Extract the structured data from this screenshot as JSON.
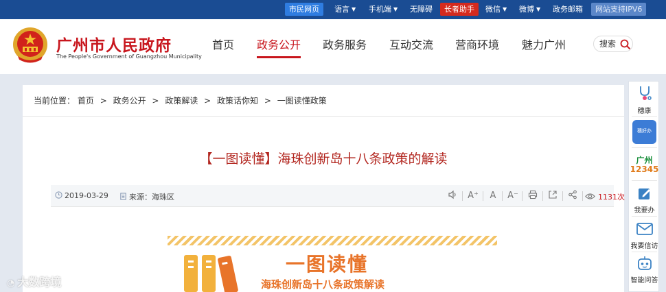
{
  "topbar": {
    "citizen": "市民网页",
    "language": "语言",
    "mobile": "手机端",
    "accessibility": "无障碍",
    "elder": "长者助手",
    "wechat": "微信",
    "weibo": "微博",
    "mail": "政务邮箱",
    "ipv6": "网站支持IPV6"
  },
  "header": {
    "title": "广州市人民政府",
    "subtitle": "The People's Government of Guangzhou Municipality",
    "nav": [
      "首页",
      "政务公开",
      "政务服务",
      "互动交流",
      "营商环境",
      "魅力广州"
    ],
    "active_tab": "政务公开",
    "search_label": "搜索"
  },
  "breadcrumb": {
    "prefix": "当前位置：",
    "items": [
      "首页",
      "政务公开",
      "政策解读",
      "政策话你知",
      "一图读懂政策"
    ],
    "separator": ">"
  },
  "article": {
    "title": "【一图读懂】海珠创新岛十八条政策的解读",
    "date": "2019-03-29",
    "source_label": "来源：",
    "source": "海珠区",
    "views": "1131次"
  },
  "banner": {
    "heading": "一图读懂",
    "subheading": "海珠创新岛十八条政策解读"
  },
  "sidebar": {
    "items": [
      "穗康",
      "穗好办",
      "广州",
      "12345",
      "我要办",
      "我要信访",
      "智能问答"
    ]
  },
  "watermark": "大数跨境",
  "colors": {
    "topbar": "#1a4c93",
    "accent_red": "#c8161d",
    "banner_orange": "#e8742a",
    "page_bg": "#e3e8f0"
  }
}
